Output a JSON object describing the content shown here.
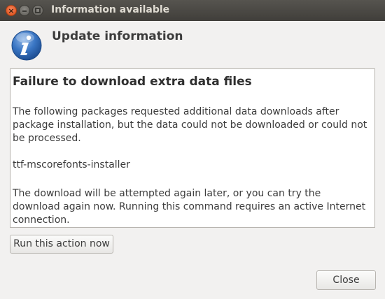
{
  "window": {
    "title": "Information available",
    "close_glyph": "×",
    "min_glyph": "",
    "max_glyph": ""
  },
  "header": {
    "icon": "info-icon",
    "title": "Update information"
  },
  "message": {
    "title": "Failure to download extra data files",
    "paragraph1": "The following packages requested additional data downloads after package installation, but the data could not be downloaded or could not be processed.",
    "package": "ttf-mscorefonts-installer",
    "paragraph2": "The download will be attempted again later, or you can try the download again now.  Running this command requires an active Internet connection."
  },
  "actions": {
    "run_label": "Run this action now",
    "close_label": "Close"
  },
  "colors": {
    "titlebar": "#403e3a",
    "close_button": "#e25a26",
    "background": "#f2f1f0",
    "info_icon": "#3a76c4"
  }
}
